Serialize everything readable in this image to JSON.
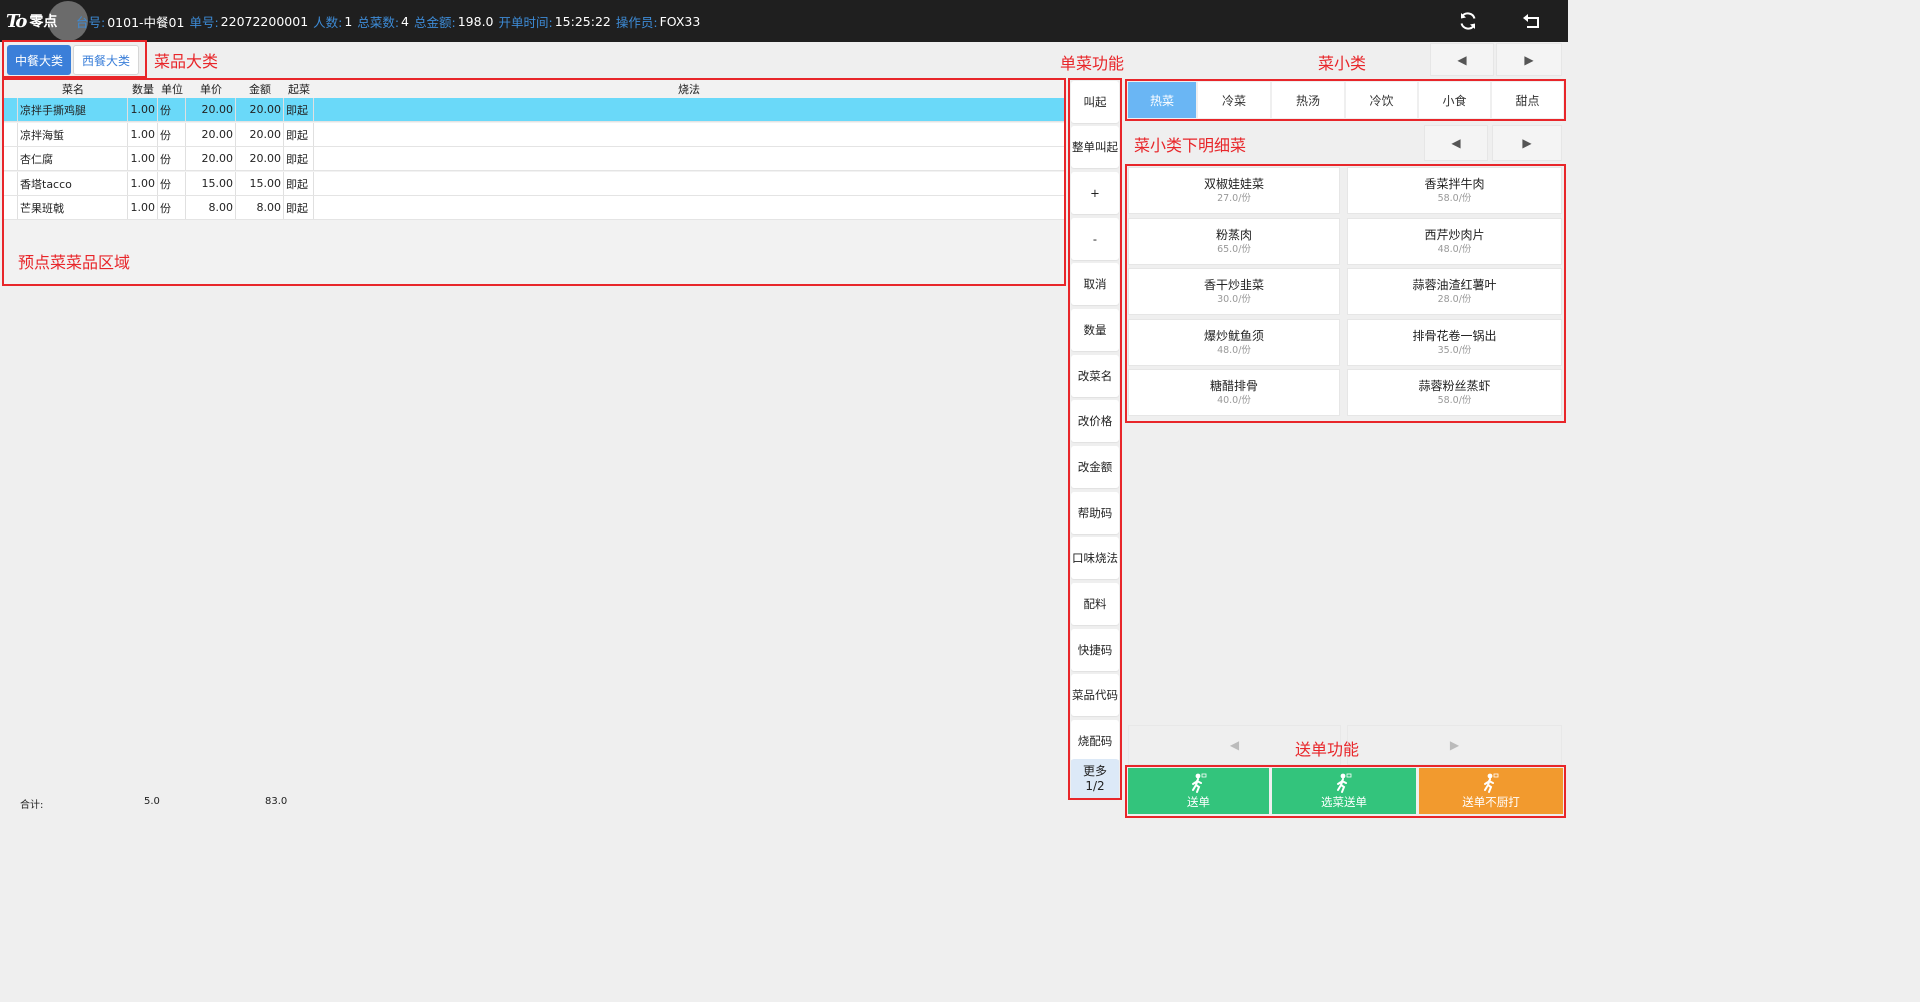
{
  "header": {
    "logo_text": "零点",
    "fields": [
      {
        "label": "台号:",
        "value": "0101-中餐01"
      },
      {
        "label": "单号:",
        "value": "22072200001"
      },
      {
        "label": "人数:",
        "value": "1"
      },
      {
        "label": "总菜数:",
        "value": "4"
      },
      {
        "label": "总金额:",
        "value": "198.0"
      },
      {
        "label": "开单时间:",
        "value": "15:25:22"
      },
      {
        "label": "操作员:",
        "value": "FOX33"
      }
    ],
    "icons": [
      "refresh-icon",
      "back-icon"
    ]
  },
  "annotations": {
    "category": "菜品大类",
    "order_area": "预点菜菜品区域",
    "single_func": "单菜功能",
    "sub_category": "菜小类",
    "sub_dishes": "菜小类下明细菜",
    "send_func": "送单功能"
  },
  "categories": [
    {
      "label": "中餐大类",
      "active": true
    },
    {
      "label": "西餐大类",
      "active": false
    }
  ],
  "order_table": {
    "headers": [
      "菜名",
      "数量",
      "单位",
      "单价",
      "金额",
      "起菜",
      "烧法"
    ],
    "rows": [
      {
        "name": "凉拌手撕鸡腿",
        "qty": "1.00",
        "unit": "份",
        "price": "20.00",
        "amount": "20.00",
        "start": "即起",
        "method": ""
      },
      {
        "name": "凉拌海蜇",
        "qty": "1.00",
        "unit": "份",
        "price": "20.00",
        "amount": "20.00",
        "start": "即起",
        "method": ""
      },
      {
        "name": "杏仁腐",
        "qty": "1.00",
        "unit": "份",
        "price": "20.00",
        "amount": "20.00",
        "start": "即起",
        "method": ""
      },
      {
        "name": "香塔tacco",
        "qty": "1.00",
        "unit": "份",
        "price": "15.00",
        "amount": "15.00",
        "start": "即起",
        "method": ""
      },
      {
        "name": "芒果班戟",
        "qty": "1.00",
        "unit": "份",
        "price": "8.00",
        "amount": "8.00",
        "start": "即起",
        "method": ""
      }
    ],
    "total_label": "合计:",
    "total_qty": "5.0",
    "total_amount": "83.0"
  },
  "functions": [
    "叫起",
    "整单叫起",
    "+",
    "-",
    "取消",
    "数量",
    "改菜名",
    "改价格",
    "改金额",
    "帮助码",
    "口味烧法",
    "配料",
    "快捷码",
    "菜品代码",
    "烧配码"
  ],
  "more": {
    "label": "更多",
    "page": "1/2"
  },
  "sub_categories": [
    {
      "label": "热菜",
      "active": true
    },
    {
      "label": "冷菜",
      "active": false
    },
    {
      "label": "热汤",
      "active": false
    },
    {
      "label": "冷饮",
      "active": false
    },
    {
      "label": "小食",
      "active": false
    },
    {
      "label": "甜点",
      "active": false
    }
  ],
  "dishes": [
    {
      "name": "双椒娃娃菜",
      "price": "27.0/份"
    },
    {
      "name": "香菜拌牛肉",
      "price": "58.0/份"
    },
    {
      "name": "粉蒸肉",
      "price": "65.0/份"
    },
    {
      "name": "西芹炒肉片",
      "price": "48.0/份"
    },
    {
      "name": "香干炒韭菜",
      "price": "30.0/份"
    },
    {
      "name": "蒜蓉油渣红薯叶",
      "price": "28.0/份"
    },
    {
      "name": "爆炒鱿鱼须",
      "price": "48.0/份"
    },
    {
      "name": "排骨花卷一锅出",
      "price": "35.0/份"
    },
    {
      "name": "糖醋排骨",
      "price": "40.0/份"
    },
    {
      "name": "蒜蓉粉丝蒸虾",
      "price": "58.0/份"
    }
  ],
  "send_buttons": [
    {
      "label": "送单",
      "color": "#33c47c"
    },
    {
      "label": "选菜送单",
      "color": "#33c47c"
    },
    {
      "label": "送单不厨打",
      "color": "#f29a2e"
    }
  ],
  "colors": {
    "accent": "#3b7fd9",
    "selected_row": "#6ad9f9",
    "annotation": "#e8262a"
  }
}
